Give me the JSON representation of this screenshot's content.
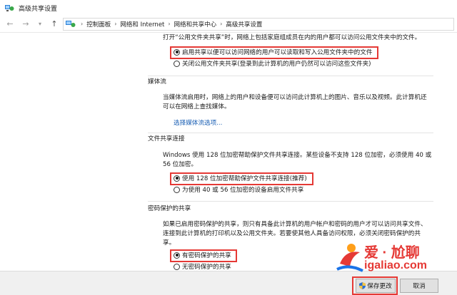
{
  "window": {
    "title": "高级共享设置"
  },
  "address": {
    "crumbs": [
      "控制面板",
      "网络和 Internet",
      "网络和共享中心",
      "高级共享设置"
    ]
  },
  "public_folder": {
    "intro": "打开“公用文件夹共享”时，网络上包括家庭组成员在内的用户都可以访问公用文件夹中的文件。",
    "options": [
      {
        "label": "启用共享以便可以访问网络的用户可以读取和写入公用文件夹中的文件",
        "checked": true
      },
      {
        "label": "关闭公用文件夹共享(登录到此计算机的用户仍然可以访问这些文件夹)",
        "checked": false
      }
    ]
  },
  "media": {
    "title": "媒体流",
    "desc_line1": "当媒体流启用时，网络上的用户和设备便可以访问此计算机上的图片、音乐以及视频。此计算机还",
    "desc_line2": "可以在网络上查找媒体。",
    "link": "选择媒体流选项..."
  },
  "file_sharing": {
    "title": "文件共享连接",
    "desc_line1": "Windows 使用 128 位加密帮助保护文件共享连接。某些设备不支持 128 位加密，必须使用 40 或",
    "desc_line2": "56 位加密。",
    "options": [
      {
        "label": "使用 128 位加密帮助保护文件共享连接(推荐)",
        "checked": true
      },
      {
        "label": "为使用 40 或 56 位加密的设备启用文件共享",
        "checked": false
      }
    ]
  },
  "password": {
    "title": "密码保护的共享",
    "desc_line1": "如果已启用密码保护的共享，则只有具备此计算机的用户帐户和密码的用户才可以访问共享文件、",
    "desc_line2": "连接到此计算机的打印机以及公用文件夹。若要使其他人具备访问权限，必须关闭密码保护的共",
    "desc_line3": "享。",
    "options": [
      {
        "label": "有密码保护的共享",
        "checked": true
      },
      {
        "label": "无密码保护的共享",
        "checked": false
      }
    ]
  },
  "buttons": {
    "save": "保存更改",
    "cancel": "取消"
  },
  "watermark": {
    "brand": "爱 · 尬聊",
    "url": "igaliao.com"
  },
  "colors": {
    "highlight": "#e53935",
    "link": "#1a5fb4"
  }
}
